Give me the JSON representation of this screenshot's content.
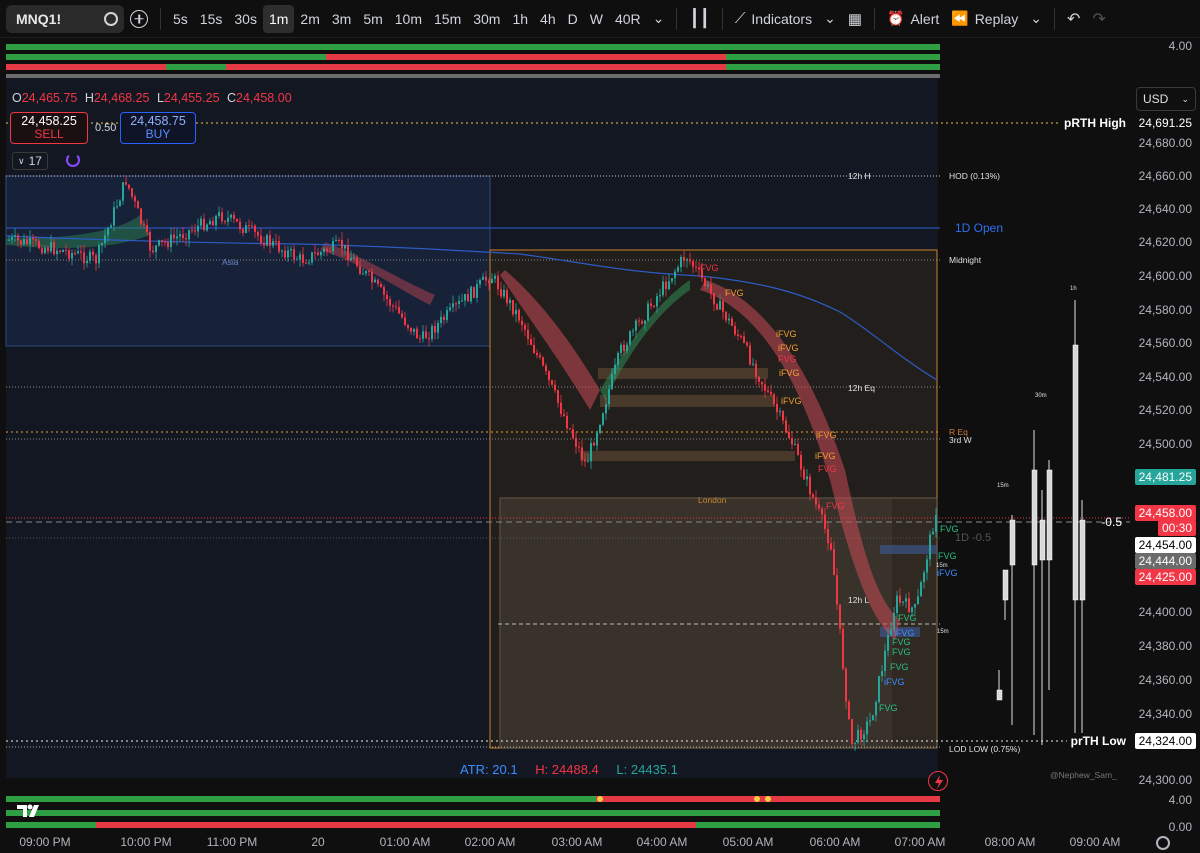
{
  "toolbar": {
    "symbol": "MNQ1!",
    "intervals": [
      "5s",
      "15s",
      "30s",
      "1m",
      "2m",
      "3m",
      "5m",
      "10m",
      "15m",
      "30m",
      "1h",
      "4h",
      "D",
      "W",
      "40R"
    ],
    "active_interval": "1m",
    "indicators_label": "Indicators",
    "alert_label": "Alert",
    "replay_label": "Replay"
  },
  "legend": {
    "o_label": "O",
    "o": "24,465.75",
    "h_label": "H",
    "h": "24,468.25",
    "l_label": "L",
    "l": "24,455.25",
    "c_label": "C",
    "c": "24,458.00"
  },
  "trade": {
    "sell_price": "24,458.25",
    "sell_label": "SELL",
    "spread": "0.50",
    "buy_price": "24,458.75",
    "buy_label": "BUY",
    "indicator_count": "17"
  },
  "price_axis": {
    "currency": "USD",
    "ticks": [
      "24,680.00",
      "24,660.00",
      "24,640.00",
      "24,620.00",
      "24,600.00",
      "24,580.00",
      "24,560.00",
      "24,540.00",
      "24,520.00",
      "24,500.00",
      "24,400.00",
      "24,380.00",
      "24,360.00",
      "24,340.00",
      "24,300.00"
    ],
    "top_pane_value": "4.00",
    "bottom_pane_values": [
      "4.00",
      "0.00"
    ],
    "tags": {
      "prth_high": "24,691.25",
      "prth_high_label": "pRTH High",
      "green": "24,481.25",
      "last": "24,458.00",
      "countdown": "00:30",
      "white": "24,454.00",
      "grey": "24,444.00",
      "red": "24,425.00",
      "prth_low": "24,324.00",
      "prth_low_label": "prTH Low",
      "minus_half": "-0.5"
    }
  },
  "levels": {
    "hod": "HOD (0.13%)",
    "h12": "12h H",
    "open1d": "1D Open",
    "midnight": "Midnight",
    "eq12": "12h Eq",
    "req": "R Eq",
    "w3": "3rd W",
    "d1half": "1D -0.5",
    "l12": "12h L",
    "lod": "LOD LOW (0.75%)",
    "asia": "Asia",
    "london": "London",
    "m15": "15m",
    "m30": "30m",
    "h1": "1h"
  },
  "fvg_labels": [
    "FVG",
    "iFVG"
  ],
  "stats": {
    "atr": "ATR: 20.1",
    "h": "H: 24488.4",
    "l": "L: 24435.1"
  },
  "watermark": "@Nephew_Sam_",
  "time_axis": [
    "09:00 PM",
    "10:00 PM",
    "11:00 PM",
    "20",
    "01:00 AM",
    "02:00 AM",
    "03:00 AM",
    "04:00 AM",
    "05:00 AM",
    "06:00 AM",
    "07:00 AM",
    "08:00 AM",
    "09:00 AM"
  ],
  "colors": {
    "bull": "#26a69a",
    "bear": "#f23645",
    "accent": "#2962ff",
    "session_box": "#c8822a"
  }
}
